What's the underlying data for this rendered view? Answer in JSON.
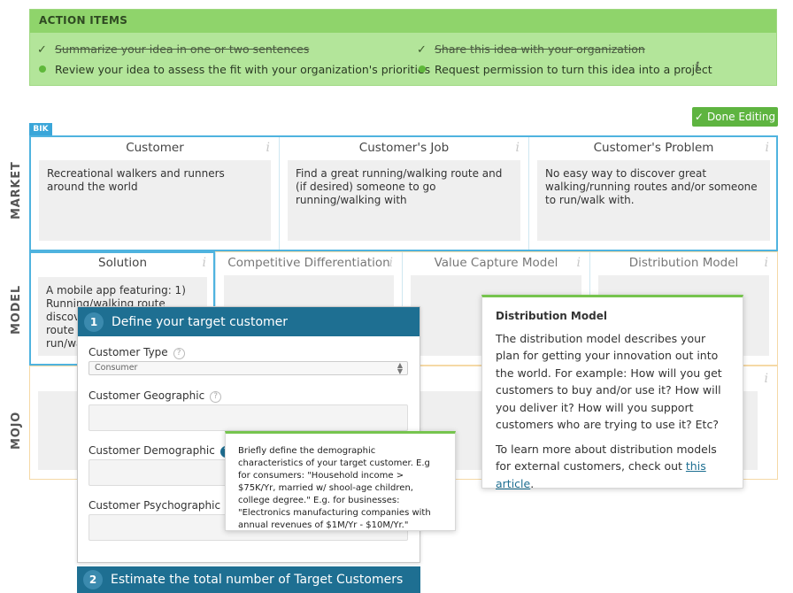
{
  "action_items": {
    "header": "ACTION ITEMS",
    "items": [
      {
        "text": "Summarize your idea in one or two sentences",
        "done": true
      },
      {
        "text": "Share this idea with your organization",
        "done": true
      },
      {
        "text": "Review your idea to assess the fit with your organization's priorities",
        "done": false
      },
      {
        "text": "Request permission to turn this idea into a project",
        "done": false
      }
    ],
    "check_glyph": "✓",
    "info_glyph": "i"
  },
  "toolbar": {
    "done_editing_label": "Done Editing"
  },
  "canvas": {
    "tag": "BIK",
    "rows": {
      "market": "MARKET",
      "model": "MODEL",
      "mojo": "MOJO"
    },
    "info_glyph": "i",
    "market": [
      {
        "title": "Customer",
        "body": "Recreational walkers and runners around the world"
      },
      {
        "title": "Customer's Job",
        "body": "Find a great running/walking route and (if desired) someone to go running/walking with"
      },
      {
        "title": "Customer's Problem",
        "body": "No easy way to discover great walking/running routes and/or someone to run/walk with."
      }
    ],
    "model": [
      {
        "title": "Solution",
        "body_lines": [
          "A mobile app featuring: 1)",
          "Running/walking route",
          "discov",
          "route s",
          "run/wa"
        ]
      },
      {
        "title": "Competitive Differentiation"
      },
      {
        "title": "Value Capture Model"
      },
      {
        "title": "Distribution Model"
      }
    ]
  },
  "form": {
    "step1_number": "1",
    "step1_title": "Define your target customer",
    "customer_type_label": "Customer Type",
    "customer_type_value": "Consumer",
    "geographic_label": "Customer Geographic",
    "demographic_label": "Customer Demographic",
    "psychographic_label": "Customer Psychographic",
    "help_glyph": "?",
    "step2_number": "2",
    "step2_title": "Estimate the total number of Target Customers"
  },
  "demographic_tooltip": "Briefly define the demographic characteristics of your target customer. E.g for consumers: \"Household income > $75K/Yr, married w/ shool-age children, college degree.\" E.g. for businesses: \"Electronics manufacturing companies with annual revenues of $1M/Yr - $10M/Yr.\"",
  "distribution_popover": {
    "title": "Distribution Model",
    "para1": "The distribution model describes your plan for getting your innovation out into the world. For example: How will you get customers to buy and/or use it? How will you deliver it? How will you support customers who are trying to use it? Etc?",
    "para2_prefix": "To learn more about distribution models for external customers, check out ",
    "link_text": "this article",
    "para2_suffix": "."
  },
  "colors": {
    "action_bg": "#b3e59a",
    "action_header": "#8fd46b",
    "accent_blue": "#1e6f92",
    "canvas_border": "#4fb3df",
    "done_btn": "#5eb440"
  }
}
